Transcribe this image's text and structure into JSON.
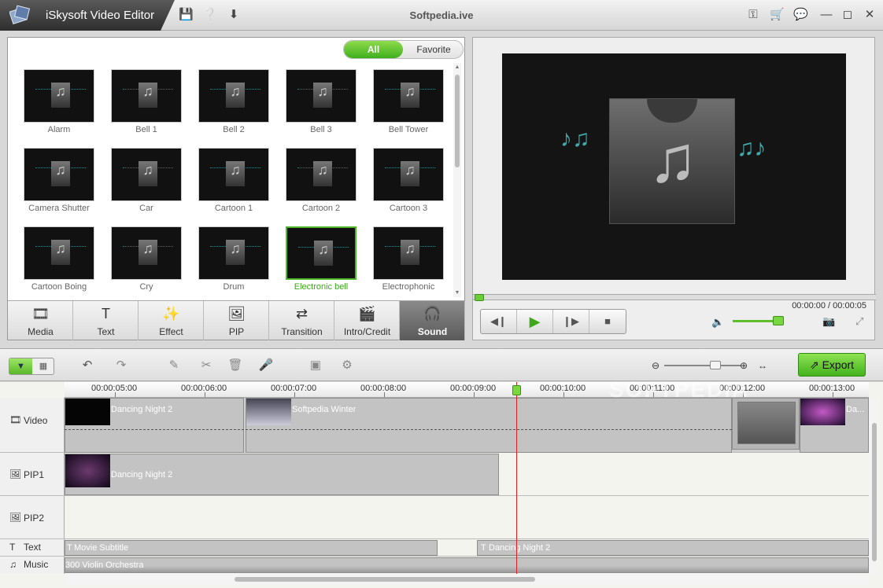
{
  "app": {
    "name": "iSkysoft Video Editor",
    "window_title": "Softpedia.ive"
  },
  "library": {
    "filter_all": "All",
    "filter_favorite": "Favorite",
    "items": [
      {
        "label": "Alarm"
      },
      {
        "label": "Bell 1"
      },
      {
        "label": "Bell 2"
      },
      {
        "label": "Bell 3"
      },
      {
        "label": "Bell Tower"
      },
      {
        "label": "Camera Shutter"
      },
      {
        "label": "Car"
      },
      {
        "label": "Cartoon 1"
      },
      {
        "label": "Cartoon 2"
      },
      {
        "label": "Cartoon 3"
      },
      {
        "label": "Cartoon Boing"
      },
      {
        "label": "Cry"
      },
      {
        "label": "Drum"
      },
      {
        "label": "Electronic bell",
        "selected": true
      },
      {
        "label": "Electrophonic"
      }
    ],
    "tabs": [
      {
        "label": "Media",
        "icon": "film-icon"
      },
      {
        "label": "Text",
        "icon": "text-icon"
      },
      {
        "label": "Effect",
        "icon": "wand-icon"
      },
      {
        "label": "PIP",
        "icon": "pip-icon"
      },
      {
        "label": "Transition",
        "icon": "transition-icon"
      },
      {
        "label": "Intro/Credit",
        "icon": "clapper-icon"
      },
      {
        "label": "Sound",
        "icon": "headphones-icon",
        "active": true
      }
    ]
  },
  "preview": {
    "timecode": "00:00:00 / 00:00:05",
    "volume_level": 0.72
  },
  "toolbar": {
    "export_label": "Export"
  },
  "timeline": {
    "ruler": [
      "00:00:05:00",
      "00:00:06:00",
      "00:00:07:00",
      "00:00:08:00",
      "00:00:09:00",
      "00:00:10:00",
      "00:00:11:00",
      "00:00:12:00",
      "00:00:13:00"
    ],
    "tracks": {
      "video": "Video",
      "pip1": "PIP1",
      "pip2": "PIP2",
      "text": "Text",
      "music": "Music"
    },
    "clips": {
      "video_1": "Dancing Night 2",
      "video_2": "Softpedia Winter",
      "video_3": "Da...",
      "pip1_1": "Dancing Night 2",
      "text_1": "Movie Subtitle",
      "text_2": "Dancing Night 2",
      "music_1": "300 Violin Orchestra"
    }
  },
  "colors": {
    "accent": "#4fb62a",
    "playhead": "#e02020"
  },
  "watermark": "SOFTPEDIA"
}
